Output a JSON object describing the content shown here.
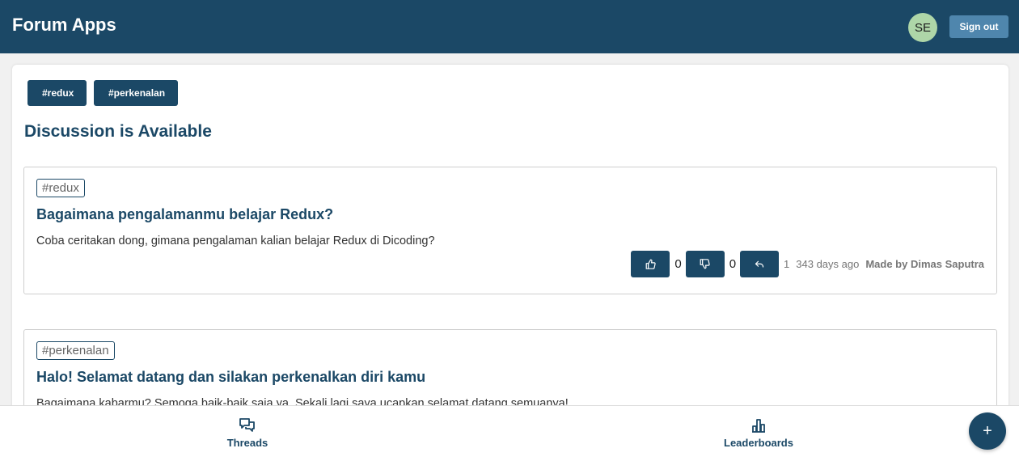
{
  "header": {
    "title": "Forum Apps",
    "avatar_initials": "SE",
    "signout_label": "Sign out"
  },
  "filters": [
    "#redux",
    "#perkenalan"
  ],
  "main": {
    "heading": "Discussion is Available"
  },
  "threads": [
    {
      "tag": "#redux",
      "title": "Bagaimana pengalamanmu belajar Redux?",
      "body": "Coba ceritakan dong, gimana pengalaman kalian belajar Redux di Dicoding?",
      "upvotes": "0",
      "downvotes": "0",
      "replies": "1",
      "age": "343 days ago",
      "author": "Made by Dimas Saputra"
    },
    {
      "tag": "#perkenalan",
      "title": "Halo! Selamat datang dan silakan perkenalkan diri kamu",
      "body": "Bagaimana kabarmu? Semoga baik-baik saja ya. Sekali lagi saya ucapkan selamat datang semuanya!"
    }
  ],
  "bottom_nav": {
    "threads_label": "Threads",
    "leaderboards_label": "Leaderboards"
  },
  "fab_label": "+",
  "colors": {
    "primary": "#1b4866",
    "signout": "#4f86ad",
    "avatar": "#aed6a8"
  }
}
